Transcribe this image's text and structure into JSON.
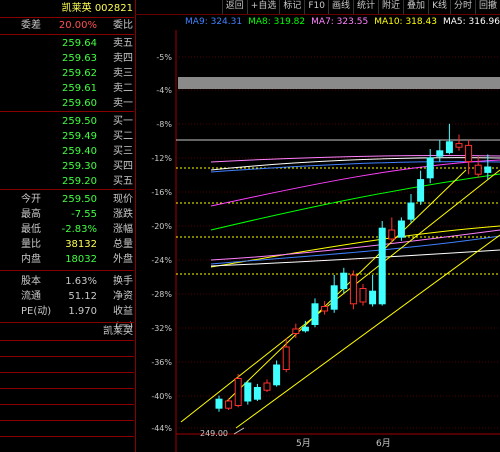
{
  "toolbar": {
    "items": [
      "回撤",
      "分时",
      "K线",
      "叠加",
      "附近",
      "统计",
      "画线",
      "F10",
      "标记",
      "+自选",
      "返回"
    ]
  },
  "ma_bar": {
    "items": [
      {
        "label": "MA5: 316.96",
        "color": "#ffffff"
      },
      {
        "label": "MA10: 318.43",
        "color": "#ffff00"
      },
      {
        "label": "MA7: 323.55",
        "color": "#ff80ff"
      },
      {
        "label": "MA8: 319.82",
        "color": "#00ff00"
      },
      {
        "label": "MA9: 324.31",
        "color": "#4080ff"
      }
    ]
  },
  "stock": {
    "code": "002821",
    "name": "凯莱英",
    "title": "凯莱英 002821"
  },
  "quote": {
    "weibi": {
      "label": "委比",
      "value": "20.00%",
      "value2": "委差",
      "v2": ""
    },
    "sells": [
      {
        "label": "卖五",
        "price": "259.64"
      },
      {
        "label": "卖四",
        "price": "259.63"
      },
      {
        "label": "卖三",
        "price": "259.62"
      },
      {
        "label": "卖二",
        "price": "259.61"
      },
      {
        "label": "卖一",
        "price": "259.60"
      }
    ],
    "buys": [
      {
        "label": "买一",
        "price": "259.50"
      },
      {
        "label": "买二",
        "price": "259.49"
      },
      {
        "label": "买三",
        "price": "259.40"
      },
      {
        "label": "买四",
        "price": "259.30"
      },
      {
        "label": "买五",
        "price": "259.20"
      }
    ],
    "stats": [
      {
        "label": "现价",
        "value": "259.50",
        "label2": "今开",
        "value2": ""
      },
      {
        "label": "涨跌",
        "value": "-7.55",
        "label2": "最高",
        "value2": ""
      },
      {
        "label": "涨幅",
        "value": "-2.83%",
        "label2": "最低",
        "value2": ""
      },
      {
        "label": "总量",
        "value": "38132",
        "label2": "量比",
        "value2": ""
      },
      {
        "label": "外盘",
        "value": "18032",
        "label2": "内盘",
        "value2": ""
      }
    ],
    "stats2": [
      {
        "label": "换手",
        "value": "1.63%",
        "label2": "股本",
        "value2": ""
      },
      {
        "label": "净资",
        "value": "51.12",
        "label2": "流通",
        "value2": ""
      },
      {
        "label": "收益(一)",
        "value": "1.970",
        "label2": "PE(动)",
        "value2": ""
      }
    ],
    "footer_name": "凯莱英"
  },
  "chart_data": {
    "type": "candlestick",
    "y_axis_labels": [
      "-5%",
      "-4%",
      "-8%",
      "-12%",
      "-16%",
      "-20%",
      "-24%",
      "-28%",
      "-32%",
      "-36%",
      "-40%",
      "-44%"
    ],
    "low_label": "249.00",
    "x_labels": [
      "5月",
      "6月"
    ],
    "candles": [
      {
        "o": 2,
        "c": 12,
        "h": 16,
        "l": -2,
        "up": true
      },
      {
        "o": 10,
        "c": 2,
        "h": 13,
        "l": 0,
        "up": false
      },
      {
        "o": 5,
        "c": 35,
        "h": 40,
        "l": 3,
        "up": false
      },
      {
        "o": 30,
        "c": 10,
        "h": 33,
        "l": 6,
        "up": true
      },
      {
        "o": 12,
        "c": 25,
        "h": 29,
        "l": 10,
        "up": true
      },
      {
        "o": 22,
        "c": 30,
        "h": 34,
        "l": 20,
        "up": false
      },
      {
        "o": 28,
        "c": 50,
        "h": 55,
        "l": 26,
        "up": true
      },
      {
        "o": 45,
        "c": 70,
        "h": 80,
        "l": 42,
        "up": false
      },
      {
        "o": 90,
        "c": 85,
        "h": 96,
        "l": 80,
        "up": false
      },
      {
        "o": 88,
        "c": 92,
        "h": 99,
        "l": 86,
        "up": true
      },
      {
        "o": 95,
        "c": 118,
        "h": 124,
        "l": 92,
        "up": true
      },
      {
        "o": 115,
        "c": 110,
        "h": 121,
        "l": 106,
        "up": false
      },
      {
        "o": 112,
        "c": 138,
        "h": 150,
        "l": 108,
        "up": true
      },
      {
        "o": 135,
        "c": 152,
        "h": 158,
        "l": 130,
        "up": true
      },
      {
        "o": 150,
        "c": 118,
        "h": 155,
        "l": 112,
        "up": false
      },
      {
        "o": 120,
        "c": 135,
        "h": 140,
        "l": 116,
        "up": false
      },
      {
        "o": 132,
        "c": 118,
        "h": 150,
        "l": 115,
        "up": true
      },
      {
        "o": 118,
        "c": 202,
        "h": 210,
        "l": 116,
        "up": true
      },
      {
        "o": 200,
        "c": 190,
        "h": 214,
        "l": 186,
        "up": false
      },
      {
        "o": 192,
        "c": 210,
        "h": 214,
        "l": 188,
        "up": true
      },
      {
        "o": 212,
        "c": 230,
        "h": 240,
        "l": 208,
        "up": true
      },
      {
        "o": 232,
        "c": 256,
        "h": 266,
        "l": 228,
        "up": true
      },
      {
        "o": 258,
        "c": 280,
        "h": 290,
        "l": 252,
        "up": true
      },
      {
        "o": 282,
        "c": 288,
        "h": 300,
        "l": 276,
        "up": true
      },
      {
        "o": 286,
        "c": 298,
        "h": 318,
        "l": 284,
        "up": true
      },
      {
        "o": 296,
        "c": 292,
        "h": 306,
        "l": 288,
        "up": false
      },
      {
        "o": 294,
        "c": 276,
        "h": 300,
        "l": 262,
        "up": false
      },
      {
        "o": 272,
        "c": 262,
        "h": 282,
        "l": 258,
        "up": false
      },
      {
        "o": 264,
        "c": 270,
        "h": 284,
        "l": 256,
        "up": true
      }
    ]
  }
}
